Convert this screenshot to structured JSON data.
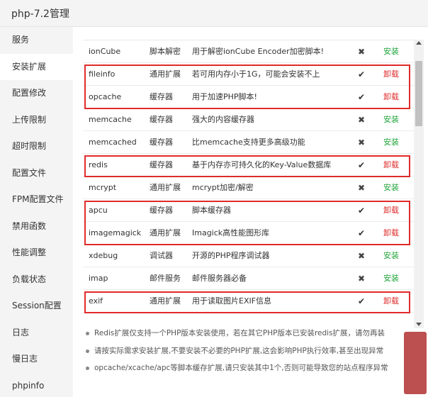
{
  "window": {
    "title": "php-7.2管理"
  },
  "sidebar": {
    "items": [
      {
        "label": "服务",
        "active": false
      },
      {
        "label": "安装扩展",
        "active": true
      },
      {
        "label": "配置修改",
        "active": false
      },
      {
        "label": "上传限制",
        "active": false
      },
      {
        "label": "超时限制",
        "active": false
      },
      {
        "label": "配置文件",
        "active": false
      },
      {
        "label": "FPM配置文件",
        "active": false
      },
      {
        "label": "禁用函数",
        "active": false
      },
      {
        "label": "性能调整",
        "active": false
      },
      {
        "label": "负载状态",
        "active": false
      },
      {
        "label": "Session配置",
        "active": false
      },
      {
        "label": "日志",
        "active": false
      },
      {
        "label": "慢日志",
        "active": false
      },
      {
        "label": "phpinfo",
        "active": false
      }
    ]
  },
  "extensions": [
    {
      "name": "ionCube",
      "type": "脚本解密",
      "desc": "用于解密ionCube Encoder加密脚本!",
      "installed": false,
      "action": "安装"
    },
    {
      "name": "fileinfo",
      "type": "通用扩展",
      "desc": "若可用内存小于1G，可能会安装不上",
      "installed": true,
      "action": "卸载"
    },
    {
      "name": "opcache",
      "type": "缓存器",
      "desc": "用于加速PHP脚本!",
      "installed": true,
      "action": "卸载"
    },
    {
      "name": "memcache",
      "type": "缓存器",
      "desc": "强大的内容缓存器",
      "installed": false,
      "action": "安装"
    },
    {
      "name": "memcached",
      "type": "缓存器",
      "desc": "比memcache支持更多高级功能",
      "installed": false,
      "action": "安装"
    },
    {
      "name": "redis",
      "type": "缓存器",
      "desc": "基于内存亦可持久化的Key-Value数据库",
      "installed": true,
      "action": "卸载"
    },
    {
      "name": "mcrypt",
      "type": "通用扩展",
      "desc": "mcrypt加密/解密",
      "installed": false,
      "action": "安装"
    },
    {
      "name": "apcu",
      "type": "缓存器",
      "desc": "脚本缓存器",
      "installed": true,
      "action": "卸载"
    },
    {
      "name": "imagemagick",
      "type": "通用扩展",
      "desc": "Imagick高性能图形库",
      "installed": true,
      "action": "卸载"
    },
    {
      "name": "xdebug",
      "type": "调试器",
      "desc": "开源的PHP程序调试器",
      "installed": false,
      "action": "安装"
    },
    {
      "name": "imap",
      "type": "邮件服务",
      "desc": "邮件服务器必备",
      "installed": false,
      "action": "安装"
    },
    {
      "name": "exif",
      "type": "通用扩展",
      "desc": "用于读取图片EXIF信息",
      "installed": true,
      "action": "卸载"
    }
  ],
  "notes": [
    "Redis扩展仅支持一个PHP版本安装使用，若在其它PHP版本已安装redis扩展，请勿再装",
    "请按实际需求安装扩展,不要安装不必要的PHP扩展,这会影响PHP执行效率,甚至出现异常",
    "opcache/xcache/apc等脚本缓存扩展,请只安装其中1个,否则可能导致您的站点程序异常"
  ],
  "icons": {
    "installed": "check-icon",
    "not_installed": "cross-icon"
  },
  "colors": {
    "install": "#20a53a",
    "uninstall": "#e02b2b",
    "highlight": "#e02b2b"
  }
}
